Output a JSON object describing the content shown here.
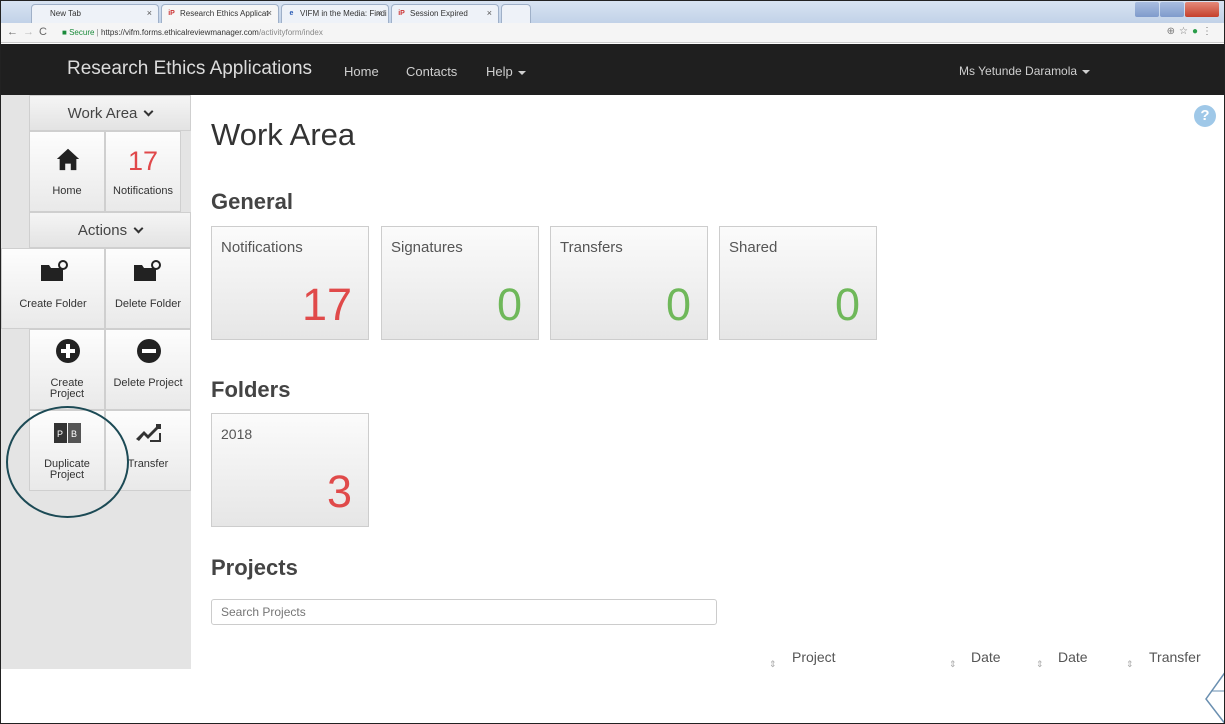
{
  "browser": {
    "tabs": [
      {
        "label": "New Tab",
        "favicon": ""
      },
      {
        "label": "Research Ethics Applicat",
        "favicon": "iP"
      },
      {
        "label": "VIFM in the Media: Findi",
        "favicon": "e"
      },
      {
        "label": "Session Expired",
        "favicon": "iP"
      }
    ],
    "url_secure": "Secure",
    "url_main": "https://vifm.forms.ethicalreviewmanager.com",
    "url_path": "/activityform/index"
  },
  "navbar": {
    "brand": "Research Ethics Applications",
    "links": [
      "Home",
      "Contacts",
      "Help"
    ],
    "user": "Ms Yetunde Daramola"
  },
  "sidebar": {
    "work_area_header": "Work Area",
    "home_label": "Home",
    "notifications_count": "17",
    "notifications_label": "Notifications",
    "actions_header": "Actions",
    "create_folder": "Create Folder",
    "delete_folder": "Delete Folder",
    "create_project": "Create Project",
    "delete_project": "Delete Project",
    "duplicate_project": "Duplicate Project",
    "transfer": "Transfer"
  },
  "main": {
    "title": "Work Area",
    "general_heading": "General",
    "cards": [
      {
        "title": "Notifications",
        "value": "17"
      },
      {
        "title": "Signatures",
        "value": "0"
      },
      {
        "title": "Transfers",
        "value": "0"
      },
      {
        "title": "Shared",
        "value": "0"
      }
    ],
    "folders_heading": "Folders",
    "folders": [
      {
        "name": "2018",
        "count": "3"
      }
    ],
    "projects_heading": "Projects",
    "search_placeholder": "Search Projects",
    "columns": [
      "Project",
      "Date",
      "Date",
      "Transfer"
    ]
  },
  "colors": {
    "navbar_bg": "#1f1f1f",
    "count_red": "#e04a4a",
    "count_green": "#6fb85a",
    "annotation_circle": "#1c4a55"
  }
}
